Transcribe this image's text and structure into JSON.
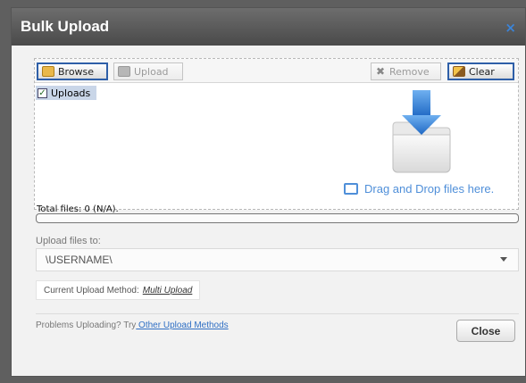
{
  "dialog": {
    "title": "Bulk Upload",
    "close_glyph": "×"
  },
  "toolbar": {
    "browse_label": "Browse",
    "upload_label": "Upload",
    "remove_label": "Remove",
    "clear_label": "Clear"
  },
  "tree": {
    "root_label": "Uploads"
  },
  "dropzone": {
    "text": "Drag and Drop files here."
  },
  "status": {
    "total_files": "Total files: 0 (N/A).",
    "progress": 0
  },
  "destination": {
    "label": "Upload files to:",
    "value": "\\USERNAME\\"
  },
  "method": {
    "label": "Current Upload Method:",
    "value": "Multi Upload"
  },
  "footer": {
    "problems_text": "Problems Uploading? Try",
    "other_methods_link": " Other Upload Methods",
    "close_label": "Close"
  },
  "colors": {
    "accent": "#4f8fd9",
    "title_bar": "#5a5a5a",
    "link": "#2f6fc4"
  }
}
